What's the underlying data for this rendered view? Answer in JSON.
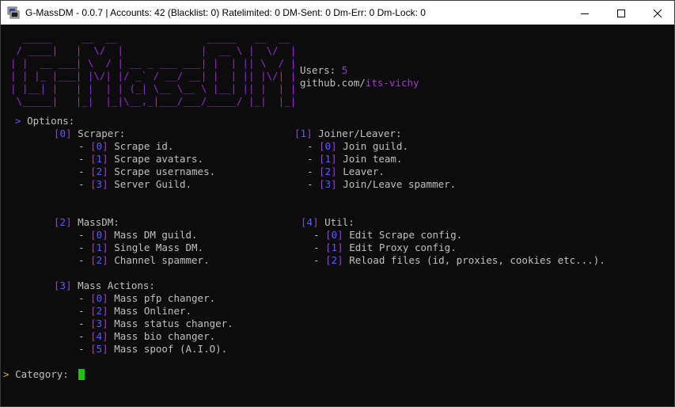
{
  "window": {
    "title": "G-MassDM - 0.0.7 | Accounts: 42 (Blacklist: 0) Ratelimited: 0 DM-Sent: 0 Dm-Err: 0 Dm-Lock: 0"
  },
  "logo": {
    "lines": [
      "  _____     __  __               _____   __  __ ",
      " / ____|   |  \\/  |             |  __ \\ |  \\/  |",
      "| |  __ ___| \\  / | __ _ ___ ___| |  | || \\  / |",
      "| | |_ |___| |\\/| |/ _` / __/ __| |  | || |\\/| |",
      "| |__| |   | |  | | (_| \\__ \\__ \\ |__| || |  | |",
      " \\_____|   |_|  |_|\\__,_|___/___/_____/ |_|  |_|"
    ]
  },
  "info": {
    "users_label": "Users: ",
    "users_value": "5",
    "github_prefix": "github.com/",
    "github_user": "its-vichy"
  },
  "options": {
    "prompt": ">",
    "title": "Options:",
    "groups": [
      {
        "index": "0",
        "name": "Scraper:",
        "items": [
          {
            "index": "0",
            "label": "Scrape id."
          },
          {
            "index": "1",
            "label": "Scrape avatars."
          },
          {
            "index": "2",
            "label": "Scrape usernames."
          },
          {
            "index": "3",
            "label": "Server Guild."
          }
        ]
      },
      {
        "index": "1",
        "name": "Joiner/Leaver:",
        "items": [
          {
            "index": "0",
            "label": "Join guild."
          },
          {
            "index": "1",
            "label": "Join team."
          },
          {
            "index": "2",
            "label": "Leaver."
          },
          {
            "index": "3",
            "label": "Join/Leave spammer."
          }
        ]
      },
      {
        "index": "2",
        "name": "MassDM:",
        "items": [
          {
            "index": "0",
            "label": "Mass DM guild."
          },
          {
            "index": "1",
            "label": "Single Mass DM."
          },
          {
            "index": "2",
            "label": "Channel spammer."
          }
        ]
      },
      {
        "index": "4",
        "name": "Util:",
        "items": [
          {
            "index": "0",
            "label": "Edit Scrape config."
          },
          {
            "index": "1",
            "label": "Edit Proxy config."
          },
          {
            "index": "2",
            "label": "Reload files (id, proxies, cookies etc...)."
          }
        ]
      },
      {
        "index": "3",
        "name": "Mass Actions:",
        "items": [
          {
            "index": "0",
            "label": "Mass pfp changer."
          },
          {
            "index": "2",
            "label": "Mass Onliner."
          },
          {
            "index": "3",
            "label": "Mass status changer."
          },
          {
            "index": "4",
            "label": "Mass bio changer."
          },
          {
            "index": "5",
            "label": "Mass spoof (A.I.O)."
          }
        ]
      }
    ]
  },
  "input": {
    "prompt": ">",
    "label": "Category: "
  },
  "icons": {
    "app": "console-icon",
    "minimize": "minimize-icon",
    "maximize": "maximize-icon",
    "close": "close-icon"
  },
  "colors": {
    "logo": "#9d2bd0",
    "index": "#5b5bff",
    "bracket": "#a23bd6",
    "prompt": "#c9b24a",
    "cursor": "#16c60c"
  }
}
